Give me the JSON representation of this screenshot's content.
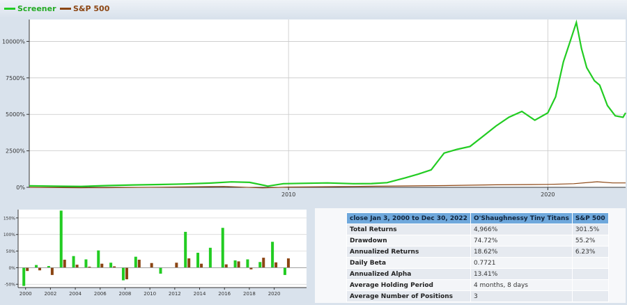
{
  "legend": [
    {
      "label": "Screener",
      "color": "#22cc22"
    },
    {
      "label": "S&P 500",
      "color": "#8b4513"
    }
  ],
  "chart_data": [
    {
      "type": "line",
      "x_ticks": [
        "2010",
        "2020"
      ],
      "y_ticks": [
        "0%",
        "2500%",
        "5000%",
        "7500%",
        "10000%"
      ],
      "ylim": [
        0,
        11500
      ],
      "xlim": [
        2000.0,
        2023.0
      ],
      "grid": true,
      "legend_position": "top-left",
      "series": [
        {
          "name": "Screener",
          "color": "#22cc22",
          "x": [
            2000.0,
            2001.0,
            2002.0,
            2003.0,
            2004.0,
            2005.0,
            2006.0,
            2007.0,
            2007.8,
            2008.5,
            2009.2,
            2009.8,
            2010.5,
            2011.5,
            2012.5,
            2013.2,
            2013.8,
            2014.5,
            2015.0,
            2015.5,
            2016.0,
            2016.5,
            2017.0,
            2017.5,
            2018.0,
            2018.5,
            2019.0,
            2019.5,
            2020.0,
            2020.3,
            2020.6,
            2020.9,
            2021.1,
            2021.3,
            2021.5,
            2021.8,
            2022.0,
            2022.3,
            2022.6,
            2022.9,
            2023.0
          ],
          "y": [
            100,
            80,
            60,
            120,
            160,
            190,
            230,
            290,
            370,
            340,
            80,
            250,
            270,
            300,
            250,
            260,
            320,
            650,
            900,
            1200,
            2350,
            2600,
            2800,
            3500,
            4200,
            4800,
            5200,
            4600,
            5100,
            6200,
            8600,
            10200,
            11300,
            9500,
            8200,
            7300,
            7000,
            5600,
            4900,
            4800,
            5100
          ]
        },
        {
          "name": "S&P 500",
          "color": "#8b4513",
          "x": [
            2000.0,
            2002.0,
            2003.0,
            2005.0,
            2007.5,
            2009.0,
            2010.0,
            2013.0,
            2016.0,
            2018.0,
            2020.0,
            2021.0,
            2021.9,
            2022.5,
            2023.0
          ],
          "y": [
            0,
            -30,
            -25,
            10,
            60,
            -40,
            20,
            70,
            120,
            170,
            200,
            250,
            380,
            300,
            302
          ]
        }
      ]
    },
    {
      "type": "bar",
      "categories": [
        "2000",
        "2001",
        "2002",
        "2003",
        "2004",
        "2005",
        "2006",
        "2007",
        "2008",
        "2009",
        "2010",
        "2011",
        "2012",
        "2013",
        "2014",
        "2015",
        "2016",
        "2017",
        "2018",
        "2019",
        "2020",
        "2021",
        "2022"
      ],
      "x_ticks": [
        "2000",
        "2002",
        "2004",
        "2006",
        "2008",
        "2010",
        "2012",
        "2014",
        "2016",
        "2018",
        "2020"
      ],
      "y_ticks": [
        "-50%",
        "0%",
        "50%",
        "100%",
        "150%"
      ],
      "ylim": [
        -60,
        175
      ],
      "series": [
        {
          "name": "Screener",
          "color": "#22cc22",
          "values": [
            -55,
            8,
            5,
            172,
            35,
            25,
            52,
            15,
            -38,
            33,
            0,
            -18,
            0,
            108,
            45,
            60,
            120,
            22,
            25,
            17,
            78,
            -22,
            0
          ]
        },
        {
          "name": "S&P 500",
          "color": "#8b4513",
          "values": [
            -10,
            -8,
            -22,
            24,
            9,
            3,
            12,
            4,
            -35,
            24,
            14,
            0,
            15,
            28,
            12,
            0,
            10,
            19,
            -5,
            30,
            16,
            28,
            0
          ]
        }
      ]
    }
  ],
  "table": {
    "headers": [
      "close Jan 3, 2000 to Dec 30, 2022",
      "O'Shaughnessy Tiny Titans",
      "S&P 500"
    ],
    "rows": [
      {
        "label": "Total Returns",
        "screener": "4,966%",
        "sp": "301.5%"
      },
      {
        "label": "Drawdown",
        "screener": "74.72%",
        "sp": "55.2%"
      },
      {
        "label": "Annualized Returns",
        "screener": "18.62%",
        "sp": "6.23%"
      },
      {
        "label": "Daily Beta",
        "screener": "0.7721",
        "sp": ""
      },
      {
        "label": "Annualized Alpha",
        "screener": "13.41%",
        "sp": ""
      },
      {
        "label": "Average Holding Period",
        "screener": "4 months, 8 days",
        "sp": ""
      },
      {
        "label": "Average Number of Positions",
        "screener": "3",
        "sp": ""
      }
    ]
  }
}
